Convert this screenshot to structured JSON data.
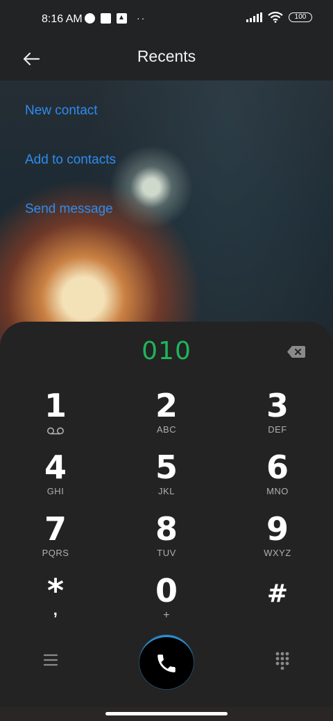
{
  "status": {
    "time": "8:16 AM",
    "battery": "100"
  },
  "header": {
    "title": "Recents"
  },
  "actions": [
    {
      "label": "New contact"
    },
    {
      "label": "Add to contacts"
    },
    {
      "label": "Send message"
    }
  ],
  "dialer": {
    "number": "010",
    "number_color": "#1fb45a",
    "keys": [
      {
        "digit": "1",
        "letters": "",
        "icon": "voicemail-icon"
      },
      {
        "digit": "2",
        "letters": "ABC"
      },
      {
        "digit": "3",
        "letters": "DEF"
      },
      {
        "digit": "4",
        "letters": "GHI"
      },
      {
        "digit": "5",
        "letters": "JKL"
      },
      {
        "digit": "6",
        "letters": "MNO"
      },
      {
        "digit": "7",
        "letters": "PQRS"
      },
      {
        "digit": "8",
        "letters": "TUV"
      },
      {
        "digit": "9",
        "letters": "WXYZ"
      },
      {
        "digit": "*",
        "letters": ","
      },
      {
        "digit": "0",
        "letters": "+"
      },
      {
        "digit": "#",
        "letters": ""
      }
    ]
  },
  "colors": {
    "accent_link": "#2d8cf0",
    "call_ring": "#2a8fd8"
  }
}
